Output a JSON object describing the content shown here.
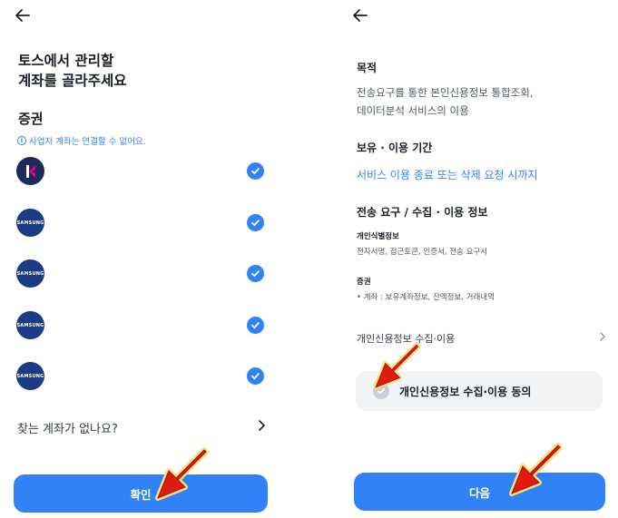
{
  "left": {
    "title_line1": "토스에서 관리할",
    "title_line2": "계좌를 골라주세요",
    "section": "증권",
    "notice": "사업자 계좌는 연결할 수 없어요.",
    "accounts": [
      {
        "logo": "kiwoom-logo",
        "selected": true
      },
      {
        "logo": "SAMSUNG",
        "selected": true
      },
      {
        "logo": "SAMSUNG",
        "selected": true
      },
      {
        "logo": "SAMSUNG",
        "selected": true
      },
      {
        "logo": "SAMSUNG",
        "selected": true
      }
    ],
    "missing": "찾는 계좌가 없나요?",
    "confirm": "확인"
  },
  "right": {
    "purpose_label": "목적",
    "purpose_line1": "전송요구를 통한 본인신용정보 통합조회,",
    "purpose_line2": "데이터분석 서비스의 이용",
    "period_label": "보유 · 이용 기간",
    "period_value": "서비스 이용 종료 또는 삭제 요청 시까지",
    "info_label": "전송 요구 / 수집 · 이용 정보",
    "id_label": "개인식별정보",
    "id_value": "전자서명, 접근토큰, 인증서, 전송 요구서",
    "sec_label": "증권",
    "sec_value": "•  계좌 : 보유계좌정보, 잔액정보, 거래내역",
    "consent_link": "개인신용정보 수집·이용",
    "agree": "개인신용정보 수집·이용 동의",
    "agree_checked": false,
    "next": "다음"
  },
  "colors": {
    "accent": "#3182f6",
    "arrow": "#e01b12",
    "arrow_glow": "#f6e27a"
  }
}
